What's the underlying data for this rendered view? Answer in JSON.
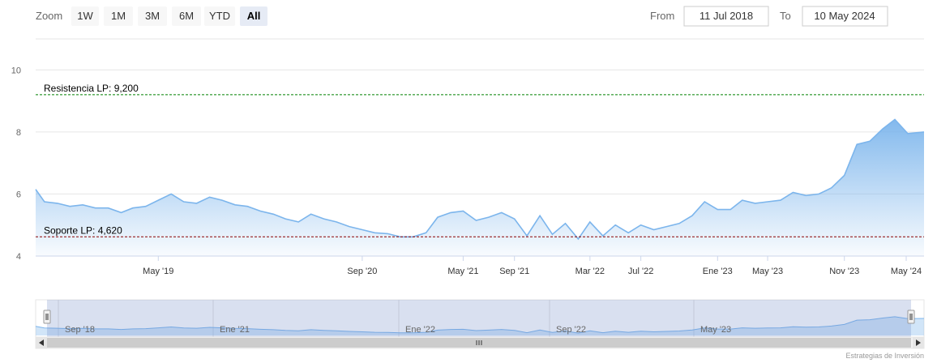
{
  "range_selector": {
    "zoom_label": "Zoom",
    "buttons": [
      "1W",
      "1M",
      "3M",
      "6M",
      "YTD",
      "All"
    ],
    "active": "All",
    "from_label": "From",
    "from_value": "11 Jul 2018",
    "to_label": "To",
    "to_value": "10 May 2024"
  },
  "credits": "Estrategias de Inversión",
  "colors": {
    "line": "#7cb5ec",
    "resistance": "#008000",
    "support": "#8b0000"
  },
  "chart_data": {
    "type": "area",
    "yticks": [
      4,
      6,
      8,
      10
    ],
    "ylim": [
      4,
      11
    ],
    "xticks": [
      {
        "label": "May '19",
        "date": "2019-05-01"
      },
      {
        "label": "Sep '20",
        "date": "2020-09-01"
      },
      {
        "label": "May '21",
        "date": "2021-05-01"
      },
      {
        "label": "Sep '21",
        "date": "2021-09-01"
      },
      {
        "label": "Mar '22",
        "date": "2022-03-01"
      },
      {
        "label": "Jul '22",
        "date": "2022-07-01"
      },
      {
        "label": "Ene '23",
        "date": "2023-01-01"
      },
      {
        "label": "May '23",
        "date": "2023-05-01"
      },
      {
        "label": "Nov '23",
        "date": "2023-11-01"
      },
      {
        "label": "May '24",
        "date": "2024-05-01"
      }
    ],
    "navigator_ticks": [
      "Sep '18",
      "Ene '21",
      "Ene '22",
      "Sep '22",
      "May '23"
    ],
    "plot_lines": [
      {
        "label": "Resistencia LP: 9,200",
        "value": 9.2,
        "color": "#008000"
      },
      {
        "label": "Soporte LP: 4,620",
        "value": 4.62,
        "color": "#8b0000"
      }
    ],
    "series": [
      {
        "values": [
          [
            "2018-07-11",
            6.15
          ],
          [
            "2018-08-01",
            5.75
          ],
          [
            "2018-09-01",
            5.7
          ],
          [
            "2018-10-01",
            5.6
          ],
          [
            "2018-11-01",
            5.65
          ],
          [
            "2018-12-01",
            5.55
          ],
          [
            "2019-01-01",
            5.55
          ],
          [
            "2019-02-01",
            5.4
          ],
          [
            "2019-03-01",
            5.55
          ],
          [
            "2019-04-01",
            5.6
          ],
          [
            "2019-05-01",
            5.8
          ],
          [
            "2019-06-01",
            6.0
          ],
          [
            "2019-07-01",
            5.75
          ],
          [
            "2019-08-01",
            5.7
          ],
          [
            "2019-09-01",
            5.9
          ],
          [
            "2019-10-01",
            5.8
          ],
          [
            "2019-11-01",
            5.65
          ],
          [
            "2019-12-01",
            5.6
          ],
          [
            "2020-01-01",
            5.45
          ],
          [
            "2020-02-01",
            5.35
          ],
          [
            "2020-03-01",
            5.2
          ],
          [
            "2020-04-01",
            5.1
          ],
          [
            "2020-05-01",
            5.35
          ],
          [
            "2020-06-01",
            5.2
          ],
          [
            "2020-07-01",
            5.1
          ],
          [
            "2020-08-01",
            4.95
          ],
          [
            "2020-09-01",
            4.85
          ],
          [
            "2020-10-01",
            4.75
          ],
          [
            "2020-11-01",
            4.72
          ],
          [
            "2020-12-01",
            4.62
          ],
          [
            "2021-01-01",
            4.62
          ],
          [
            "2021-02-01",
            4.75
          ],
          [
            "2021-03-01",
            5.25
          ],
          [
            "2021-04-01",
            5.4
          ],
          [
            "2021-05-01",
            5.45
          ],
          [
            "2021-06-01",
            5.15
          ],
          [
            "2021-07-01",
            5.25
          ],
          [
            "2021-08-01",
            5.4
          ],
          [
            "2021-09-01",
            5.2
          ],
          [
            "2021-10-01",
            4.65
          ],
          [
            "2021-11-01",
            5.3
          ],
          [
            "2021-12-01",
            4.7
          ],
          [
            "2022-01-01",
            5.05
          ],
          [
            "2022-02-01",
            4.55
          ],
          [
            "2022-03-01",
            5.1
          ],
          [
            "2022-04-01",
            4.65
          ],
          [
            "2022-05-01",
            5.0
          ],
          [
            "2022-06-01",
            4.75
          ],
          [
            "2022-07-01",
            5.0
          ],
          [
            "2022-08-01",
            4.85
          ],
          [
            "2022-09-01",
            4.95
          ],
          [
            "2022-10-01",
            5.05
          ],
          [
            "2022-11-01",
            5.3
          ],
          [
            "2022-12-01",
            5.75
          ],
          [
            "2023-01-01",
            5.5
          ],
          [
            "2023-02-01",
            5.5
          ],
          [
            "2023-03-01",
            5.8
          ],
          [
            "2023-04-01",
            5.7
          ],
          [
            "2023-05-01",
            5.75
          ],
          [
            "2023-06-01",
            5.8
          ],
          [
            "2023-07-01",
            6.05
          ],
          [
            "2023-08-01",
            5.95
          ],
          [
            "2023-09-01",
            6.0
          ],
          [
            "2023-10-01",
            6.2
          ],
          [
            "2023-11-01",
            6.6
          ],
          [
            "2023-12-01",
            7.6
          ],
          [
            "2024-01-01",
            7.7
          ],
          [
            "2024-02-01",
            8.1
          ],
          [
            "2024-03-01",
            8.4
          ],
          [
            "2024-04-01",
            7.95
          ],
          [
            "2024-05-10",
            8.0
          ]
        ]
      }
    ]
  }
}
